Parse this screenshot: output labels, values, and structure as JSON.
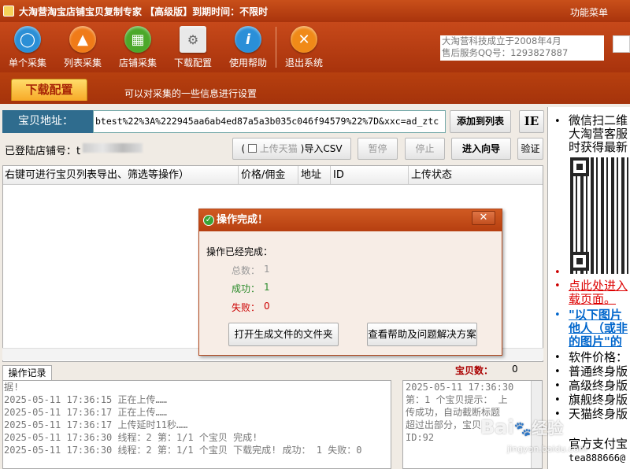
{
  "app": {
    "title": "大淘营淘宝店铺宝贝复制专家 【高级版】到期时间：不限时",
    "menu": "功能菜单"
  },
  "toolbar": {
    "buttons": [
      {
        "label": "单个采集",
        "icon": "single-collect-icon",
        "color": "#2b8fd6"
      },
      {
        "label": "列表采集",
        "icon": "list-collect-icon",
        "color": "#f07b18"
      },
      {
        "label": "店铺采集",
        "icon": "shop-collect-icon",
        "color": "#4ca82a"
      },
      {
        "label": "下载配置",
        "icon": "download-config-icon",
        "color": "#cfcfcf"
      },
      {
        "label": "使用帮助",
        "icon": "help-icon",
        "color": "#2a8fd8"
      },
      {
        "label": "退出系统",
        "icon": "exit-icon",
        "color": "#f08a18"
      }
    ],
    "info_line1": "大淘营科技成立于2008年4月",
    "info_line2": "售后服务QQ号：1293827887"
  },
  "subbar": {
    "tab": "下载配置",
    "desc": "可以对采集的一些信息进行设置"
  },
  "url": {
    "label": "宝贝地址：",
    "value": "btest%22%3A%222945aa6ab4ed87a5a3b035c046f94579%22%7D&xxc=ad_ztc",
    "add_button": "添加到列表",
    "ie_button": "IE"
  },
  "shop": {
    "label": "已登陆店铺号：t",
    "upload_tmall_checkbox": "上传天猫",
    "paren_open": "(",
    "import_csv": ")导入CSV",
    "pause": "暂停",
    "stop": "停止",
    "wizard": "进入向导",
    "verify": "验证"
  },
  "grid": {
    "columns": [
      "右键可进行宝贝列表导出、筛选等操作）",
      "价格/佣金",
      "地址",
      "ID",
      "上传状态"
    ]
  },
  "dialog": {
    "title": "操作完成！",
    "close": "✕",
    "message": "操作已经完成：",
    "total_label": "总数：",
    "total_value": "1",
    "success_label": "成功：",
    "success_value": "1",
    "fail_label": "失败：",
    "fail_value": "0",
    "open_folder_button": "打开生成文件的文件夹",
    "help_button": "查看帮助及问题解决方案"
  },
  "log": {
    "tab": "操作记录",
    "count_label": "宝贝数：",
    "count_value": "0",
    "lines": [
      "据!",
      "2025-05-11 17:36:15 正在上传……",
      "2025-05-11 17:36:17 正在上传……",
      "2025-05-11 17:36:17 上传延时11秒……",
      "2025-05-11 17:36:30 线程：2 第：1/1 个宝贝 完成!",
      "2025-05-11 17:36:30 线程：2 第：1/1 个宝贝 下载完成! 成功： 1 失败：0"
    ],
    "right_lines": [
      "2025-05-11 17:36:30",
      "第：1 个宝贝提示： 上",
      "传成功，自动截断标题",
      "超过出部分，宝贝",
      "ID:92"
    ]
  },
  "side": {
    "items": [
      {
        "text": "微信扫二维",
        "color": "#000"
      },
      {
        "text": "大淘营客服",
        "color": "#000"
      },
      {
        "text": "时获得最新",
        "color": "#000"
      }
    ],
    "link1a": "点此处进入",
    "link1b": "载页面。",
    "link2a": "\"以下图片",
    "link2b": "他人（或非",
    "link2c": "的图片\"的",
    "prices_label": "软件价格：",
    "editions": [
      "普通终身版",
      "高级终身版",
      "旗舰终身版",
      "天猫终身版"
    ],
    "pay_label": "官方支付宝",
    "pay_account": "tea888666@"
  },
  "watermark": {
    "brand": "Bai",
    "brand2": "经验",
    "url": "jingyan.baidu.com"
  }
}
